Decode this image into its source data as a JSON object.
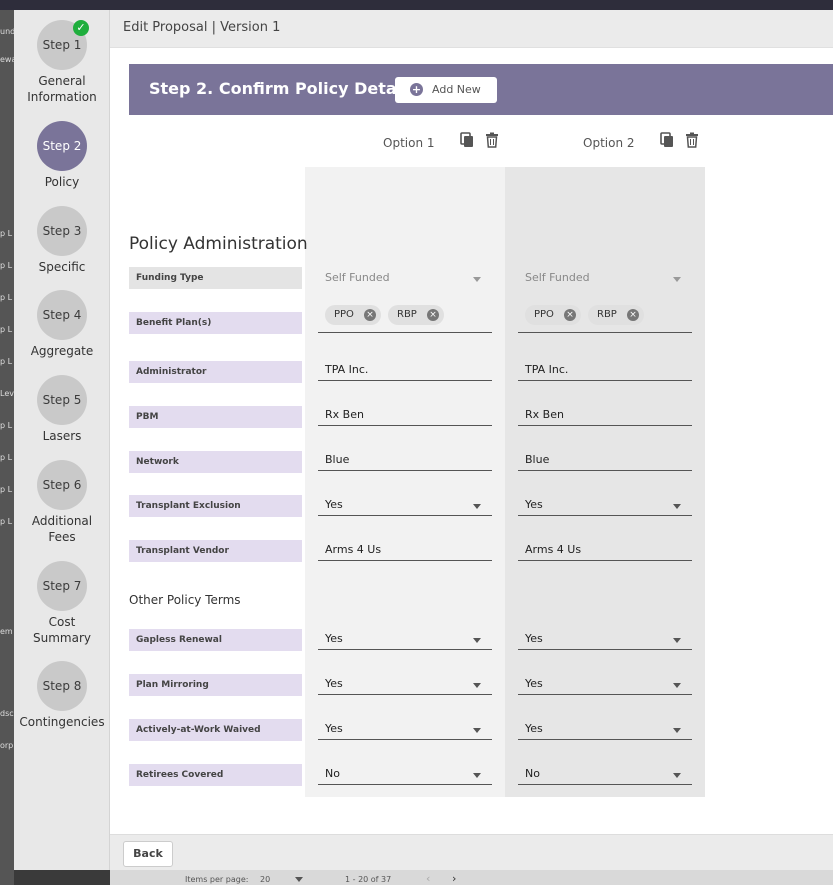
{
  "window": {
    "title": "Edit Proposal | Version 1"
  },
  "steps": [
    {
      "num": "Step 1",
      "label": "General Information",
      "done": true
    },
    {
      "num": "Step 2",
      "label": "Policy",
      "active": true
    },
    {
      "num": "Step 3",
      "label": "Specific"
    },
    {
      "num": "Step 4",
      "label": "Aggregate"
    },
    {
      "num": "Step 5",
      "label": "Lasers"
    },
    {
      "num": "Step 6",
      "label": "Additional Fees"
    },
    {
      "num": "Step 7",
      "label": "Cost Summary"
    },
    {
      "num": "Step 8",
      "label": "Contingencies"
    }
  ],
  "header": {
    "title": "Step 2. Confirm Policy Details",
    "add_new": "Add New"
  },
  "options": [
    {
      "label": "Option 1"
    },
    {
      "label": "Option 2"
    }
  ],
  "section": {
    "policy_admin": "Policy Administration",
    "other_terms": "Other Policy Terms"
  },
  "rows": {
    "funding_type": {
      "label": "Funding Type",
      "values": [
        "Self Funded",
        "Self Funded"
      ]
    },
    "benefit_plans": {
      "label": "Benefit Plan(s)",
      "chips": [
        [
          "PPO",
          "RBP"
        ],
        [
          "PPO",
          "RBP"
        ]
      ]
    },
    "administrator": {
      "label": "Administrator",
      "values": [
        "TPA Inc.",
        "TPA Inc."
      ]
    },
    "pbm": {
      "label": "PBM",
      "values": [
        "Rx Ben",
        "Rx Ben"
      ]
    },
    "network": {
      "label": "Network",
      "values": [
        "Blue",
        "Blue"
      ]
    },
    "transplant_exclusion": {
      "label": "Transplant Exclusion",
      "values": [
        "Yes",
        "Yes"
      ]
    },
    "transplant_vendor": {
      "label": "Transplant Vendor",
      "values": [
        "Arms 4 Us",
        "Arms 4 Us"
      ]
    },
    "gapless_renewal": {
      "label": "Gapless Renewal",
      "values": [
        "Yes",
        "Yes"
      ]
    },
    "plan_mirroring": {
      "label": "Plan Mirroring",
      "values": [
        "Yes",
        "Yes"
      ]
    },
    "actively_at_work": {
      "label": "Actively-at-Work Waived",
      "values": [
        "Yes",
        "Yes"
      ]
    },
    "retirees_covered": {
      "label": "Retirees Covered",
      "values": [
        "No",
        "No"
      ]
    }
  },
  "footer": {
    "back": "Back"
  },
  "backdrop": {
    "pagination": {
      "items_per_page_label": "Items per page:",
      "items_per_page": "20",
      "range": "1 - 20 of 37"
    }
  }
}
